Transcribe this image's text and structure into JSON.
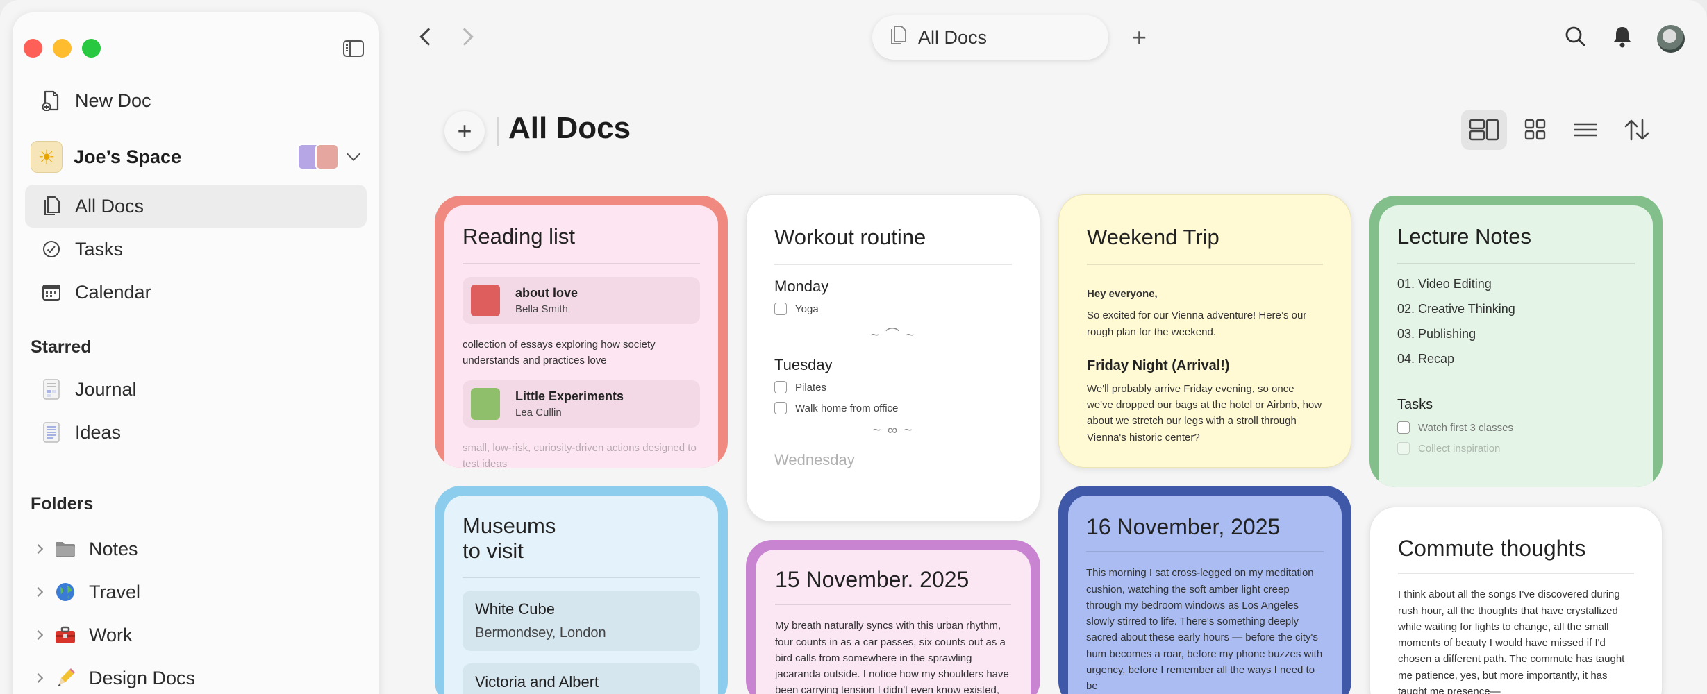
{
  "sidebar": {
    "new_doc": "New Doc",
    "space": {
      "name": "Joe’s Space",
      "avatar_icon": "sun-icon"
    },
    "nav": [
      {
        "label": "All Docs",
        "icon": "docs-icon",
        "active": true
      },
      {
        "label": "Tasks",
        "icon": "check-circle-icon"
      },
      {
        "label": "Calendar",
        "icon": "calendar-icon"
      }
    ],
    "starred_heading": "Starred",
    "starred": [
      {
        "label": "Journal",
        "icon": "journal-doc-icon"
      },
      {
        "label": "Ideas",
        "icon": "ideas-doc-icon"
      }
    ],
    "folders_heading": "Folders",
    "folders": [
      {
        "label": "Notes",
        "icon": "folder-icon"
      },
      {
        "label": "Travel",
        "icon": "globe-icon"
      },
      {
        "label": "Work",
        "icon": "toolbox-icon"
      },
      {
        "label": "Design Docs",
        "icon": "pencil-icon"
      }
    ]
  },
  "topbar": {
    "tab_label": "All Docs"
  },
  "header": {
    "title": "All Docs"
  },
  "colors": {
    "reading_border": "#f08a80",
    "reading_bg": "#fde6f2",
    "lecture_border": "#82bf8a",
    "lecture_bg": "#e4f4e6",
    "museums_border": "#8ccdee",
    "museums_bg": "#e4f3fb",
    "nov15_border": "#c884d0",
    "nov15_bg": "#fbe6f4",
    "nov16_border": "#3f58a8",
    "nov16_bg": "#aabcf2",
    "weekend_bg": "#fff9d4"
  },
  "cards": {
    "reading": {
      "title": "Reading list",
      "book1_title": "about love",
      "book1_author": "Bella Smith",
      "desc1": "collection of essays exploring how society understands and practices love",
      "book2_title": "Little Experiments",
      "book2_author": "Lea Cullin",
      "desc2": "small, low-risk, curiosity-driven actions designed to test ideas"
    },
    "workout": {
      "title": "Workout routine",
      "day1": "Monday",
      "day1_item1": "Yoga",
      "day2": "Tuesday",
      "day2_item1": "Pilates",
      "day2_item2": "Walk home from office",
      "day3": "Wednesday"
    },
    "weekend": {
      "title": "Weekend Trip",
      "greeting": "Hey everyone,",
      "intro": "So excited for our Vienna adventure! Here’s our rough plan for the weekend.",
      "section": "Friday Night (Arrival!)",
      "section_text": "We'll probably arrive Friday evening, so once we've dropped our bags at the hotel or Airbnb, how about we stretch our legs with a stroll through Vienna's historic center?"
    },
    "lecture": {
      "title": "Lecture Notes",
      "items": [
        "01. Video Editing",
        "02. Creative Thinking",
        "03. Publishing",
        "04. Recap"
      ],
      "tasks_heading": "Tasks",
      "task1": "Watch first 3 classes",
      "task2": "Collect inspiration"
    },
    "museums": {
      "title_line1": "Museums",
      "title_line2": "to visit",
      "item1_name": "White Cube",
      "item1_loc": "Bermondsey, London",
      "item2_name": "Victoria and Albert"
    },
    "nov15": {
      "title": "15 November. 2025",
      "text": "My breath naturally syncs with this urban rhythm, four counts in as a car passes, six counts out as a bird calls from somewhere in the sprawling jacaranda outside. I notice how my shoulders have been carrying tension I didn't even know existed, like invisible"
    },
    "nov16": {
      "title": "16 November, 2025",
      "text": "This morning I sat cross-legged on my meditation cushion, watching the soft amber light creep through my bedroom windows as Los Angeles slowly stirred to life. There's something deeply sacred about these early hours — before the city's hum becomes a roar, before my phone buzzes with urgency, before I remember all the ways I need to be"
    },
    "commute": {
      "title": "Commute thoughts",
      "text": "I think about all the songs I've discovered during rush hour, all the thoughts that have crystallized while waiting for lights to change, all the small moments of beauty I would have missed if I'd chosen a different path. The commute has taught me patience, yes, but more importantly, it has taught me presence—"
    }
  }
}
